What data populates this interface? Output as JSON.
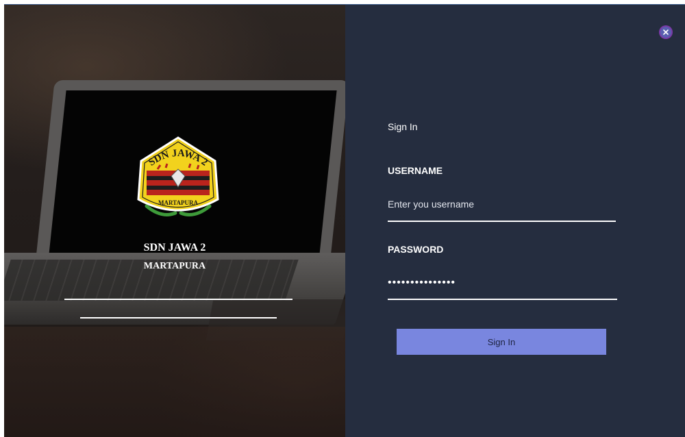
{
  "branding": {
    "school_name": "SDN JAWA 2",
    "school_city": "MARTAPURA",
    "logo_top_text": "SDN JAWA 2",
    "logo_bottom_text": "MARTAPURA"
  },
  "form": {
    "title": "Sign In",
    "username": {
      "label": "USERNAME",
      "placeholder": "Enter you username",
      "value": ""
    },
    "password": {
      "label": "PASSWORD",
      "value": "•••••••••••••••"
    },
    "submit_label": "Sign In"
  },
  "window": {
    "close_icon": "close-icon"
  },
  "colors": {
    "form_background": "#252d3f",
    "button_background": "#7986df",
    "close_accent": "#7a3aa8"
  }
}
